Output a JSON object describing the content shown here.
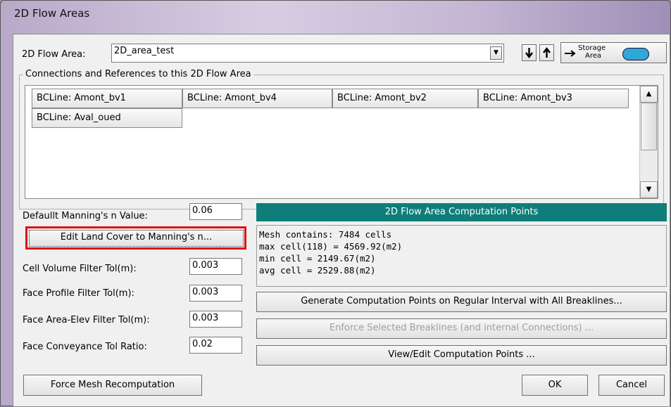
{
  "window": {
    "title": "2D Flow Areas"
  },
  "flow_area": {
    "label": "2D Flow Area:",
    "value": "2D_area_test",
    "storage_top": "Storage",
    "storage_bottom": "Area"
  },
  "connections": {
    "group_title": "Connections and References to this 2D Flow Area",
    "items": [
      "BCLine: Amont_bv1",
      "BCLine: Amont_bv4",
      "BCLine: Amont_bv2",
      "BCLine: Amont_bv3",
      "BCLine: Aval_oued"
    ]
  },
  "params": {
    "manning_label": "Defaullt Manning's n Value:",
    "manning_value": "0.06",
    "edit_land_cover_label": "Edit Land Cover to Manning's n...",
    "cell_volume_label": "Cell Volume Filter Tol(m):",
    "cell_volume_value": "0.003",
    "face_profile_label": "Face Profile Filter Tol(m):",
    "face_profile_value": "0.003",
    "face_area_label": "Face Area-Elev Filter Tol(m):",
    "face_area_value": "0.003",
    "face_conveyance_label": "Face Conveyance Tol Ratio:",
    "face_conveyance_value": "0.02"
  },
  "computation": {
    "header": "2D Flow Area Computation Points",
    "lines": [
      "Mesh contains: 7484 cells",
      "max cell(118) = 4569.92(m2)",
      "min cell = 2149.67(m2)",
      "avg cell = 2529.88(m2)"
    ],
    "generate_label": "Generate Computation Points on Regular Interval with All Breaklines...",
    "enforce_label": "Enforce Selected Breaklines (and internal Connections) ...",
    "view_edit_label": "View/Edit Computation Points ..."
  },
  "footer": {
    "force_mesh_label": "Force Mesh Recomputation",
    "ok_label": "OK",
    "cancel_label": "Cancel"
  },
  "colors": {
    "header_teal": "#0f7e7a",
    "highlight_red": "#e01010"
  }
}
